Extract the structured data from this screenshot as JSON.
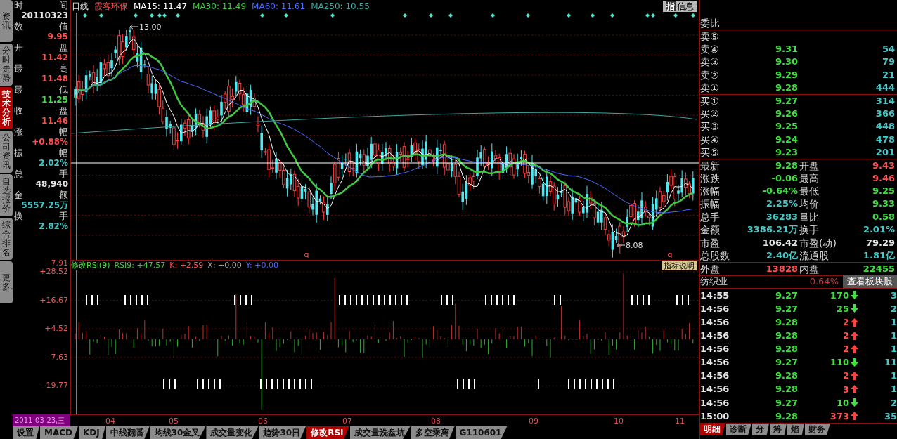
{
  "side_tabs": [
    {
      "label": "资讯",
      "selected": false
    },
    {
      "label": "分时走势",
      "selected": false
    },
    {
      "label": "技术分析",
      "selected": true
    },
    {
      "label": "公司资讯",
      "selected": false
    },
    {
      "label": "自选报价",
      "selected": false
    },
    {
      "label": "综合排名",
      "selected": false
    },
    {
      "label": "更多..",
      "selected": false
    }
  ],
  "info_panel": [
    {
      "label_left": "时",
      "label_right": "间",
      "value": "20110323",
      "color": "#e8e8e8"
    },
    {
      "label_left": "数",
      "label_right": "值",
      "value": "9.95",
      "color": "#ff5050"
    },
    {
      "label_left": "开",
      "label_right": "盘",
      "value": "11.42",
      "color": "#ff5050"
    },
    {
      "label_left": "最",
      "label_right": "高",
      "value": "11.48",
      "color": "#ff5050"
    },
    {
      "label_left": "最",
      "label_right": "低",
      "value": "11.25",
      "color": "#40e040"
    },
    {
      "label_left": "收",
      "label_right": "盘",
      "value": "11.46",
      "color": "#ff5050"
    },
    {
      "label_left": "涨",
      "label_right": "幅",
      "value": "+0.88%",
      "color": "#ff5050"
    },
    {
      "label_left": "振",
      "label_right": "幅",
      "value": "2.02%",
      "color": "#46c8c8"
    },
    {
      "label_left": "总",
      "label_right": "手",
      "value": "48,940",
      "color": "#e8e8e8"
    },
    {
      "label_left": "金",
      "label_right": "额",
      "value": "5557.25万",
      "color": "#46c8c8"
    },
    {
      "label_left": "换",
      "label_right": "手",
      "value": "2.82%",
      "color": "#46c8c8"
    }
  ],
  "chart_header": {
    "period": "日线",
    "stock_name": "霞客环保",
    "ma": [
      {
        "text": "MA15: 11.47",
        "color": "#ffffff"
      },
      {
        "text": "MA30: 11.49",
        "color": "#40c840"
      },
      {
        "text": "MA60: 11.61",
        "color": "#4a6cff"
      },
      {
        "text": "MA250: 10.55",
        "color": "#3fa8a0"
      }
    ],
    "info_button": {
      "icon_text": "指",
      "label": "信息"
    }
  },
  "price_chart": {
    "high_label": "13.00",
    "low_label": "8.08",
    "markers": [
      "q",
      "q"
    ],
    "bottom_label": "7.91"
  },
  "indicator_header": {
    "title": "修改RSI(9)",
    "values": [
      {
        "text": "RSI9: +47.57",
        "color": "#40c840"
      },
      {
        "text": "K: +2.59",
        "color": "#ff5050"
      },
      {
        "text": "X: +0.00",
        "color": "#a0a0a0"
      },
      {
        "text": "Y: +0.00",
        "color": "#4a6cff"
      }
    ],
    "help_button": "指标说明"
  },
  "indicator_axis": [
    "+28.52",
    "+16.67",
    "+4.52",
    "-7.63",
    "-19.77"
  ],
  "date_axis": {
    "current": "2011-03-23,三",
    "months": [
      "04",
      "05",
      "06",
      "07",
      "08",
      "09",
      "10",
      "11"
    ]
  },
  "bottom_tabs": [
    {
      "label": "设置",
      "selected": false
    },
    {
      "label": "MACD",
      "selected": false
    },
    {
      "label": "KDJ",
      "selected": false
    },
    {
      "label": "中线翻番",
      "selected": false
    },
    {
      "label": "均线30金叉",
      "selected": false
    },
    {
      "label": "成交量变化",
      "selected": false
    },
    {
      "label": "趋势30日",
      "selected": false
    },
    {
      "label": "修改RSI",
      "selected": true
    },
    {
      "label": "成交量洗盘坑",
      "selected": false
    },
    {
      "label": "多空乘离",
      "selected": false
    },
    {
      "label": "G110601",
      "selected": false
    }
  ],
  "order_book": {
    "ratio_label": "委比",
    "asks": [
      {
        "label": "卖⑤"
      },
      {
        "label": "卖④",
        "price": "9.31",
        "volume": "54"
      },
      {
        "label": "卖③",
        "price": "9.30",
        "volume": "79"
      },
      {
        "label": "卖②",
        "price": "9.29",
        "volume": "21"
      },
      {
        "label": "卖①",
        "price": "9.28",
        "volume": "444"
      }
    ],
    "bids": [
      {
        "label": "买①",
        "price": "9.27",
        "volume": "314"
      },
      {
        "label": "买②",
        "price": "9.26",
        "volume": "366"
      },
      {
        "label": "买③",
        "price": "9.25",
        "volume": "448"
      },
      {
        "label": "买④",
        "price": "9.24",
        "volume": "478"
      },
      {
        "label": "买⑤",
        "price": "9.23",
        "volume": "201"
      }
    ]
  },
  "stats": [
    {
      "cells": [
        {
          "label": "最新",
          "value": "9.28",
          "color": "#40e040"
        },
        {
          "label": "开盘",
          "value": "9.43",
          "color": "#ff5050"
        }
      ]
    },
    {
      "cells": [
        {
          "label": "涨跌",
          "value": "-0.06",
          "color": "#40e040"
        },
        {
          "label": "最高",
          "value": "9.46",
          "color": "#ff5050"
        }
      ]
    },
    {
      "cells": [
        {
          "label": "涨幅",
          "value": "-0.64%",
          "color": "#40e040"
        },
        {
          "label": "最低",
          "value": "9.25",
          "color": "#40e040"
        }
      ]
    },
    {
      "cells": [
        {
          "label": "振幅",
          "value": "2.25%",
          "color": "#46c8c8"
        },
        {
          "label": "均价",
          "value": "9.33",
          "color": "#40e040"
        }
      ]
    },
    {
      "cells": [
        {
          "label": "总手",
          "value": "36283",
          "color": "#46c8c8"
        },
        {
          "label": "量比",
          "value": "0.58",
          "color": "#40e040"
        }
      ]
    },
    {
      "cells": [
        {
          "label": "金额",
          "value": "3386.21万",
          "color": "#46c8c8"
        },
        {
          "label": "换手",
          "value": "2.01%",
          "color": "#46c8c8"
        }
      ]
    },
    {
      "cells": [
        {
          "label": "市盈",
          "value": "106.42",
          "color": "#e8e8e8"
        },
        {
          "label": "市盈(动)",
          "value": "79.29",
          "color": "#e8e8e8"
        }
      ]
    },
    {
      "cells": [
        {
          "label": "总股数",
          "value": "2.40亿",
          "color": "#46c8c8"
        },
        {
          "label": "流通股",
          "value": "1.81亿",
          "color": "#46c8c8"
        }
      ]
    },
    {
      "cells": [
        {
          "label": "外盘",
          "value": "13828",
          "color": "#ff5050"
        },
        {
          "label": "内盘",
          "value": "22455",
          "color": "#40e040"
        }
      ]
    }
  ],
  "sector": {
    "name": "纺织业",
    "change": "0.64%",
    "button": "查看板块股"
  },
  "trades": [
    {
      "time": "14:55",
      "price": "9.27",
      "volume": "170",
      "kind": "sell",
      "count": "3"
    },
    {
      "time": "14:56",
      "price": "9.27",
      "volume": "25",
      "kind": "sell",
      "count": "2"
    },
    {
      "time": "14:56",
      "price": "9.28",
      "volume": "2",
      "kind": "buy",
      "count": "1"
    },
    {
      "time": "14:56",
      "price": "9.28",
      "volume": "2",
      "kind": "buy",
      "count": "1"
    },
    {
      "time": "14:56",
      "price": "9.28",
      "volume": "2",
      "kind": "buy",
      "count": "1"
    },
    {
      "time": "14:56",
      "price": "9.27",
      "volume": "110",
      "kind": "sell",
      "count": "11"
    },
    {
      "time": "14:56",
      "price": "9.28",
      "volume": "2",
      "kind": "buy",
      "count": "1"
    },
    {
      "time": "14:56",
      "price": "9.28",
      "volume": "3",
      "kind": "buy",
      "count": "1"
    },
    {
      "time": "14:56",
      "price": "9.27",
      "volume": "10",
      "kind": "sell",
      "count": "2"
    },
    {
      "time": "15:00",
      "price": "9.28",
      "volume": "373",
      "kind": "buy",
      "count": "35"
    }
  ],
  "panel_tabs": [
    {
      "label": "明细",
      "selected": true
    },
    {
      "label": "诊断",
      "selected": false
    },
    {
      "label": "分",
      "selected": false
    },
    {
      "label": "筹",
      "selected": false
    },
    {
      "label": "焰",
      "selected": false
    },
    {
      "label": "财务",
      "selected": false
    }
  ]
}
